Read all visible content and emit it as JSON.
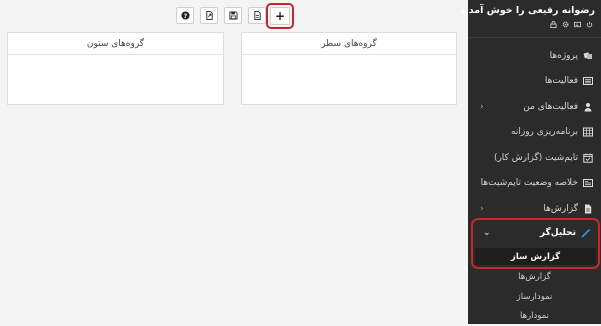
{
  "toolbar": {
    "buttons": [
      {
        "name": "help",
        "icon": "help-circle-icon"
      },
      {
        "name": "export",
        "icon": "file-export-icon"
      },
      {
        "name": "save",
        "icon": "save-icon"
      },
      {
        "name": "new-file",
        "icon": "file-icon"
      }
    ],
    "add_label": "+"
  },
  "panels": {
    "row_groups_title": "گروه‌های سطر",
    "column_groups_title": "گروه‌های ستون"
  },
  "sidebar": {
    "welcome": "رضوانه رفیعی را خوش آمدید",
    "nav": [
      {
        "label": "پروژه‌ها",
        "icon": "projects-icon"
      },
      {
        "label": "فعالیت‌ها",
        "icon": "list-icon"
      },
      {
        "label": "فعالیت‌های من",
        "icon": "user-tasks-icon",
        "has_children": true
      },
      {
        "label": "برنامه‌ریزی روزانه",
        "icon": "table-icon"
      },
      {
        "label": "تایم‌شیت (گزارش کار)",
        "icon": "calendar-check-icon"
      },
      {
        "label": "خلاصه وضعیت تایم‌شیت‌ها",
        "icon": "summary-icon"
      },
      {
        "label": "گزارش‌ها",
        "icon": "report-file-icon",
        "has_children": true
      }
    ],
    "analyzer": {
      "label": "تحلیل‌گر",
      "icon": "wand-icon",
      "active_sub": "گزارش ساز"
    },
    "sub_items": [
      "گزارش‌ها",
      "نمودارساز",
      "نمودارها"
    ]
  },
  "colors": {
    "sidebar_bg": "#2b2b2b",
    "highlight_border": "#c8262d",
    "analyzer_icon": "#3a8fd9"
  }
}
